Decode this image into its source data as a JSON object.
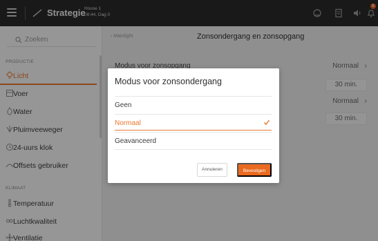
{
  "topbar": {
    "title": "Strategie",
    "house_name": "House 1",
    "house_time": "08:44, Dag 0",
    "notification_count": "6"
  },
  "sidebar": {
    "search_placeholder": "Zoeken",
    "section_production": "PRODUCTIE",
    "section_climate": "KLIMAAT",
    "items": [
      {
        "label": "Licht",
        "icon": "bulb-icon",
        "active": true
      },
      {
        "label": "Voer",
        "icon": "feed-icon"
      },
      {
        "label": "Water",
        "icon": "water-drop-icon"
      },
      {
        "label": "Pluimveeweger",
        "icon": "scale-icon"
      },
      {
        "label": "24-uurs klok",
        "icon": "clock-icon"
      },
      {
        "label": "Offsets gebruiker",
        "icon": "offset-icon"
      },
      {
        "label": "Temperatuur",
        "icon": "thermometer-icon"
      },
      {
        "label": "Luchtkwaliteit",
        "icon": "co2-icon"
      },
      {
        "label": "Ventilatie",
        "icon": "fan-icon"
      }
    ]
  },
  "main": {
    "breadcrumb": "Mainlight",
    "title": "Zonsondergang en zonsopgang",
    "rows": [
      {
        "label": "Modus voor zonsopgang",
        "value": "Normaal"
      },
      {
        "label": "",
        "value": "30 min."
      },
      {
        "label": "",
        "value": "Normaal"
      },
      {
        "label": "",
        "value": "30 min."
      }
    ]
  },
  "dialog": {
    "title": "Modus voor zonsondergang",
    "options": [
      "Geen",
      "Normaal",
      "Geavanceerd"
    ],
    "selected": "Normaal",
    "cancel_label": "Annuleren",
    "confirm_label": "Bevestigen"
  },
  "colors": {
    "accent": "#e8772e",
    "topbar": "#2b2b2b"
  }
}
